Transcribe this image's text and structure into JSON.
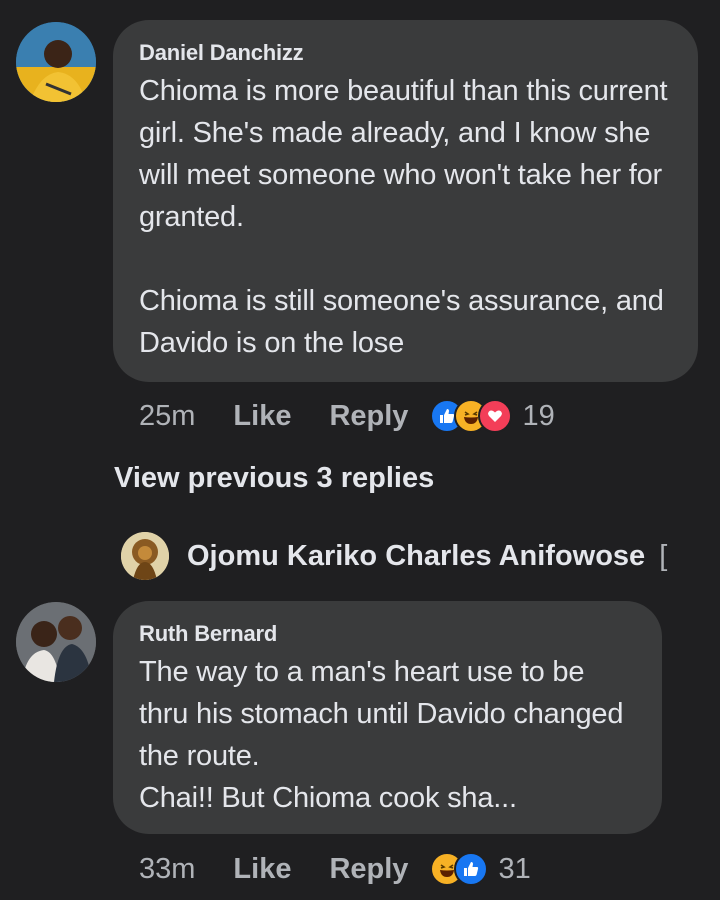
{
  "colors": {
    "background": "#1f1f21",
    "bubble": "#3a3b3c",
    "like_blue": "#1877f2",
    "love_red": "#f33e58",
    "haha_yellow": "#f7b125"
  },
  "comments": [
    {
      "author": "Daniel Danchizz",
      "text": "Chioma is more beautiful than this current girl. She's made already, and I know she will meet someone who won't take her for granted.\n\nChioma is still someone's assurance, and Davido is on the lose",
      "time": "25m",
      "like_label": "Like",
      "reply_label": "Reply",
      "reactions": [
        "like-icon",
        "haha-icon",
        "love-icon"
      ],
      "reaction_count": "19"
    },
    {
      "author": "Ruth Bernard",
      "text": "The way to a man's heart use to be thru his stomach until Davido changed the route.\nChai!! But Chioma cook sha...",
      "time": "33m",
      "like_label": "Like",
      "reply_label": "Reply",
      "reactions": [
        "haha-icon",
        "like-icon"
      ],
      "reaction_count": "31"
    }
  ],
  "thread": {
    "view_previous_label": "View previous 3 replies",
    "reply_author": "Ojomu Kariko Charles Anifowose",
    "reply_trailing_glyph": "["
  }
}
